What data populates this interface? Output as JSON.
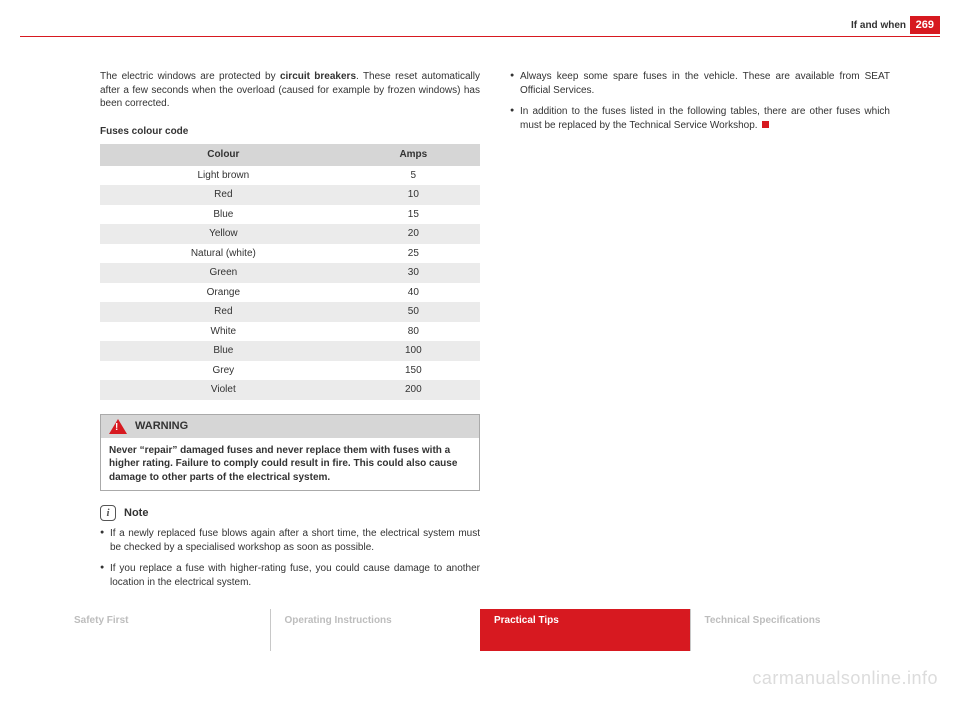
{
  "header": {
    "section": "If and when",
    "page": "269"
  },
  "left": {
    "intro_prefix": "The electric windows are protected by ",
    "intro_bold": "circuit breakers",
    "intro_suffix": ". These reset automatically after a few seconds when the overload (caused for example by frozen windows) has been corrected.",
    "table_title": "Fuses colour code",
    "warning_label": "WARNING",
    "warning_body": "Never “repair” damaged fuses and never replace them with fuses with a higher rating. Failure to comply could result in fire. This could also cause damage to other parts of the electrical system.",
    "note_label": "Note",
    "note_bullets": [
      "If a newly replaced fuse blows again after a short time, the electrical system must be checked by a specialised workshop as soon as possible.",
      "If you replace a fuse with higher-rating fuse, you could cause damage to another location in the electrical system."
    ]
  },
  "right": {
    "bullets": [
      "Always keep some spare fuses in the vehicle. These are available from SEAT Official Services.",
      "In addition to the fuses listed in the following tables, there are other fuses which must be replaced by the Technical Service Workshop."
    ]
  },
  "footer": {
    "tabs": [
      "Safety First",
      "Operating Instructions",
      "Practical Tips",
      "Technical Specifications"
    ],
    "active_index": 2
  },
  "watermark": "carmanualsonline.info",
  "chart_data": {
    "type": "table",
    "title": "Fuses colour code",
    "columns": [
      "Colour",
      "Amps"
    ],
    "rows": [
      [
        "Light brown",
        5
      ],
      [
        "Red",
        10
      ],
      [
        "Blue",
        15
      ],
      [
        "Yellow",
        20
      ],
      [
        "Natural (white)",
        25
      ],
      [
        "Green",
        30
      ],
      [
        "Orange",
        40
      ],
      [
        "Red",
        50
      ],
      [
        "White",
        80
      ],
      [
        "Blue",
        100
      ],
      [
        "Grey",
        150
      ],
      [
        "Violet",
        200
      ]
    ]
  }
}
